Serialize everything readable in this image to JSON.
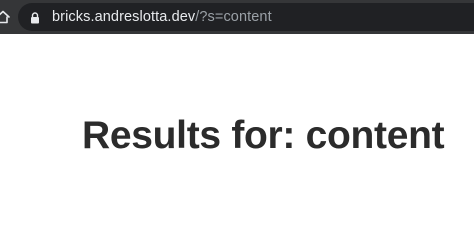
{
  "browser": {
    "url_host": "bricks.andreslotta.dev",
    "url_path": "/?s=content",
    "icons": {
      "home": "home-icon",
      "lock": "lock-icon"
    }
  },
  "main": {
    "title": "Results for: content"
  },
  "colors": {
    "toolbar_bg": "#353638",
    "addressbar_bg": "#202124",
    "url_host": "#e8eaed",
    "url_path": "#9aa0a6",
    "title_text": "#2b2b2b",
    "page_bg": "#ffffff"
  }
}
